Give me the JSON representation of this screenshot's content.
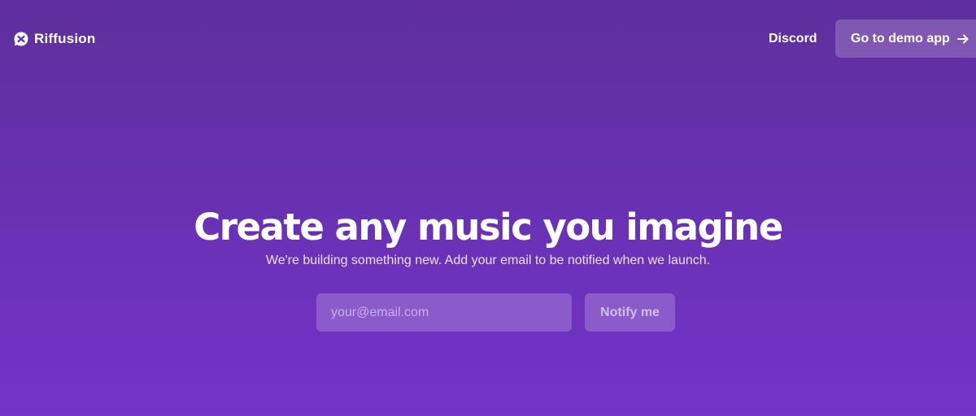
{
  "header": {
    "brand_name": "Riffusion",
    "logo_icon": "riffusion-logo-icon",
    "nav_discord": "Discord",
    "demo_button_label": "Go to demo app",
    "demo_button_icon": "arrow-right-icon"
  },
  "hero": {
    "title": "Create any music you imagine",
    "subtitle": "We're building something new. Add your email to be notified when we launch."
  },
  "signup": {
    "email_placeholder": "your@email.com",
    "email_value": "",
    "notify_label": "Notify me"
  },
  "colors": {
    "background_top": "#5f2f9c",
    "background_bottom": "#7433c9",
    "text": "#ffffff"
  }
}
